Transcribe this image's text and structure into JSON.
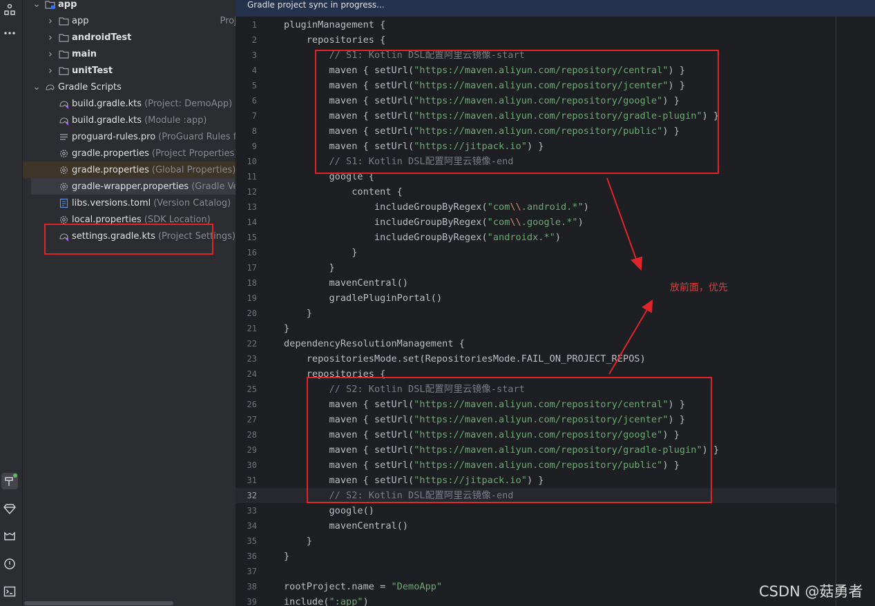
{
  "banner": "Gradle project sync in progress...",
  "tree": [
    {
      "label": "app",
      "hint": "",
      "bold": true,
      "indent": 0,
      "chevron": "down",
      "icon": "module-folder-icon"
    },
    {
      "label": "app",
      "hint": "Proje",
      "bold": false,
      "indent": 1,
      "chevron": "right",
      "icon": "folder-icon"
    },
    {
      "label": "androidTest",
      "hint": "",
      "bold": true,
      "indent": 1,
      "chevron": "right",
      "icon": "folder-icon"
    },
    {
      "label": "main",
      "hint": "",
      "bold": true,
      "indent": 1,
      "chevron": "right",
      "icon": "folder-icon"
    },
    {
      "label": "unitTest",
      "hint": "",
      "bold": true,
      "indent": 1,
      "chevron": "right",
      "icon": "folder-icon"
    },
    {
      "label": "Gradle Scripts",
      "hint": "",
      "bold": false,
      "indent": 0,
      "chevron": "down",
      "icon": "gradle-scripts-icon"
    },
    {
      "label": "build.gradle.kts",
      "hint": "(Project: DemoApp)",
      "bold": false,
      "indent": 2,
      "chevron": "",
      "icon": "gradle-kts-icon"
    },
    {
      "label": "build.gradle.kts",
      "hint": "(Module :app)",
      "bold": false,
      "indent": 2,
      "chevron": "",
      "icon": "gradle-kts-icon"
    },
    {
      "label": "proguard-rules.pro",
      "hint": "(ProGuard Rules for",
      "bold": false,
      "indent": 2,
      "chevron": "",
      "icon": "text-file-icon"
    },
    {
      "label": "gradle.properties",
      "hint": "(Project Properties)",
      "bold": false,
      "indent": 2,
      "chevron": "",
      "icon": "properties-gear-icon"
    },
    {
      "label": "gradle.properties",
      "hint": "(Global Properties)",
      "bold": false,
      "indent": 2,
      "chevron": "",
      "icon": "properties-gear-icon"
    },
    {
      "label": "gradle-wrapper.properties",
      "hint": "(Gradle Versi",
      "bold": false,
      "indent": 2,
      "chevron": "",
      "icon": "properties-gear-icon"
    },
    {
      "label": "libs.versions.toml",
      "hint": "(Version Catalog)",
      "bold": false,
      "indent": 2,
      "chevron": "",
      "icon": "toml-file-icon"
    },
    {
      "label": "local.properties",
      "hint": "(SDK Location)",
      "bold": false,
      "indent": 2,
      "chevron": "",
      "icon": "properties-gear-icon"
    },
    {
      "label": "settings.gradle.kts",
      "hint": "(Project Settings)",
      "bold": false,
      "indent": 2,
      "chevron": "",
      "icon": "gradle-kts-icon"
    }
  ],
  "code": [
    {
      "n": "1",
      "parts": [
        [
          "t",
          "pluginManagement {"
        ]
      ]
    },
    {
      "n": "2",
      "parts": [
        [
          "t",
          "    repositories {"
        ]
      ]
    },
    {
      "n": "3",
      "parts": [
        [
          "c",
          "        // S1: Kotlin DSL配置阿里云镜像-start"
        ]
      ]
    },
    {
      "n": "4",
      "parts": [
        [
          "t",
          "        maven { setUrl("
        ],
        [
          "s",
          "\"https://maven.aliyun.com/repository/central\""
        ],
        [
          "t",
          ") }"
        ]
      ]
    },
    {
      "n": "5",
      "parts": [
        [
          "t",
          "        maven { setUrl("
        ],
        [
          "s",
          "\"https://maven.aliyun.com/repository/jcenter\""
        ],
        [
          "t",
          ") }"
        ]
      ]
    },
    {
      "n": "6",
      "parts": [
        [
          "t",
          "        maven { setUrl("
        ],
        [
          "s",
          "\"https://maven.aliyun.com/repository/google\""
        ],
        [
          "t",
          ") }"
        ]
      ]
    },
    {
      "n": "7",
      "parts": [
        [
          "t",
          "        maven { setUrl("
        ],
        [
          "s",
          "\"https://maven.aliyun.com/repository/gradle-plugin\""
        ],
        [
          "t",
          ") }"
        ]
      ]
    },
    {
      "n": "8",
      "parts": [
        [
          "t",
          "        maven { setUrl("
        ],
        [
          "s",
          "\"https://maven.aliyun.com/repository/public\""
        ],
        [
          "t",
          ") }"
        ]
      ]
    },
    {
      "n": "9",
      "parts": [
        [
          "t",
          "        maven { setUrl("
        ],
        [
          "s",
          "\"https://jitpack.io\""
        ],
        [
          "t",
          ") }"
        ]
      ]
    },
    {
      "n": "10",
      "parts": [
        [
          "c",
          "        // S1: Kotlin DSL配置阿里云镜像-end"
        ]
      ]
    },
    {
      "n": "11",
      "parts": [
        [
          "t",
          "        google {"
        ]
      ]
    },
    {
      "n": "12",
      "parts": [
        [
          "t",
          "            content {"
        ]
      ]
    },
    {
      "n": "13",
      "parts": [
        [
          "t",
          "                includeGroupByRegex("
        ],
        [
          "s",
          "\"com"
        ],
        [
          "e",
          "\\\\"
        ],
        [
          "s",
          ".android.*\""
        ],
        [
          "t",
          ")"
        ]
      ]
    },
    {
      "n": "14",
      "parts": [
        [
          "t",
          "                includeGroupByRegex("
        ],
        [
          "s",
          "\"com"
        ],
        [
          "e",
          "\\\\"
        ],
        [
          "s",
          ".google.*\""
        ],
        [
          "t",
          ")"
        ]
      ]
    },
    {
      "n": "15",
      "parts": [
        [
          "t",
          "                includeGroupByRegex("
        ],
        [
          "s",
          "\"androidx.*\""
        ],
        [
          "t",
          ")"
        ]
      ]
    },
    {
      "n": "16",
      "parts": [
        [
          "t",
          "            }"
        ]
      ]
    },
    {
      "n": "17",
      "parts": [
        [
          "t",
          "        }"
        ]
      ]
    },
    {
      "n": "18",
      "parts": [
        [
          "t",
          "        mavenCentral()"
        ]
      ]
    },
    {
      "n": "19",
      "parts": [
        [
          "t",
          "        gradlePluginPortal()"
        ]
      ]
    },
    {
      "n": "20",
      "parts": [
        [
          "t",
          "    }"
        ]
      ]
    },
    {
      "n": "21",
      "parts": [
        [
          "t",
          "}"
        ]
      ]
    },
    {
      "n": "22",
      "parts": [
        [
          "t",
          "dependencyResolutionManagement {"
        ]
      ]
    },
    {
      "n": "23",
      "parts": [
        [
          "t",
          "    repositoriesMode.set(RepositoriesMode.FAIL_ON_PROJECT_REPOS)"
        ]
      ]
    },
    {
      "n": "24",
      "parts": [
        [
          "t",
          "    repositories {"
        ]
      ]
    },
    {
      "n": "25",
      "parts": [
        [
          "c",
          "        // S2: Kotlin DSL配置阿里云镜像-start"
        ]
      ]
    },
    {
      "n": "26",
      "parts": [
        [
          "t",
          "        maven { setUrl("
        ],
        [
          "s",
          "\"https://maven.aliyun.com/repository/central\""
        ],
        [
          "t",
          ") }"
        ]
      ]
    },
    {
      "n": "27",
      "parts": [
        [
          "t",
          "        maven { setUrl("
        ],
        [
          "s",
          "\"https://maven.aliyun.com/repository/jcenter\""
        ],
        [
          "t",
          ") }"
        ]
      ]
    },
    {
      "n": "28",
      "parts": [
        [
          "t",
          "        maven { setUrl("
        ],
        [
          "s",
          "\"https://maven.aliyun.com/repository/google\""
        ],
        [
          "t",
          ") }"
        ]
      ]
    },
    {
      "n": "29",
      "parts": [
        [
          "t",
          "        maven { setUrl("
        ],
        [
          "s",
          "\"https://maven.aliyun.com/repository/gradle-plugin\""
        ],
        [
          "t",
          ") }"
        ]
      ]
    },
    {
      "n": "30",
      "parts": [
        [
          "t",
          "        maven { setUrl("
        ],
        [
          "s",
          "\"https://maven.aliyun.com/repository/public\""
        ],
        [
          "t",
          ") }"
        ]
      ]
    },
    {
      "n": "31",
      "parts": [
        [
          "t",
          "        maven { setUrl("
        ],
        [
          "s",
          "\"https://jitpack.io\""
        ],
        [
          "t",
          ") }"
        ]
      ]
    },
    {
      "n": "32",
      "parts": [
        [
          "c",
          "        // S2: Kotlin DSL配置阿里云镜像-end"
        ]
      ]
    },
    {
      "n": "33",
      "parts": [
        [
          "t",
          "        google()"
        ]
      ]
    },
    {
      "n": "34",
      "parts": [
        [
          "t",
          "        mavenCentral()"
        ]
      ]
    },
    {
      "n": "35",
      "parts": [
        [
          "t",
          "    }"
        ]
      ]
    },
    {
      "n": "36",
      "parts": [
        [
          "t",
          "}"
        ]
      ]
    },
    {
      "n": "37",
      "parts": [
        [
          "t",
          ""
        ]
      ]
    },
    {
      "n": "38",
      "parts": [
        [
          "t",
          "rootProject.name = "
        ],
        [
          "s",
          "\"DemoApp\""
        ]
      ]
    },
    {
      "n": "39",
      "parts": [
        [
          "t",
          "include("
        ],
        [
          "s",
          "\":app\""
        ],
        [
          "t",
          ")"
        ]
      ]
    }
  ],
  "annotation_note": "放前面，优先",
  "watermark": "CSDN @菇勇者",
  "colors": {
    "annotation_red": "#e0242a",
    "string_green": "#6aab73",
    "comment_gray": "#7a7e85"
  }
}
